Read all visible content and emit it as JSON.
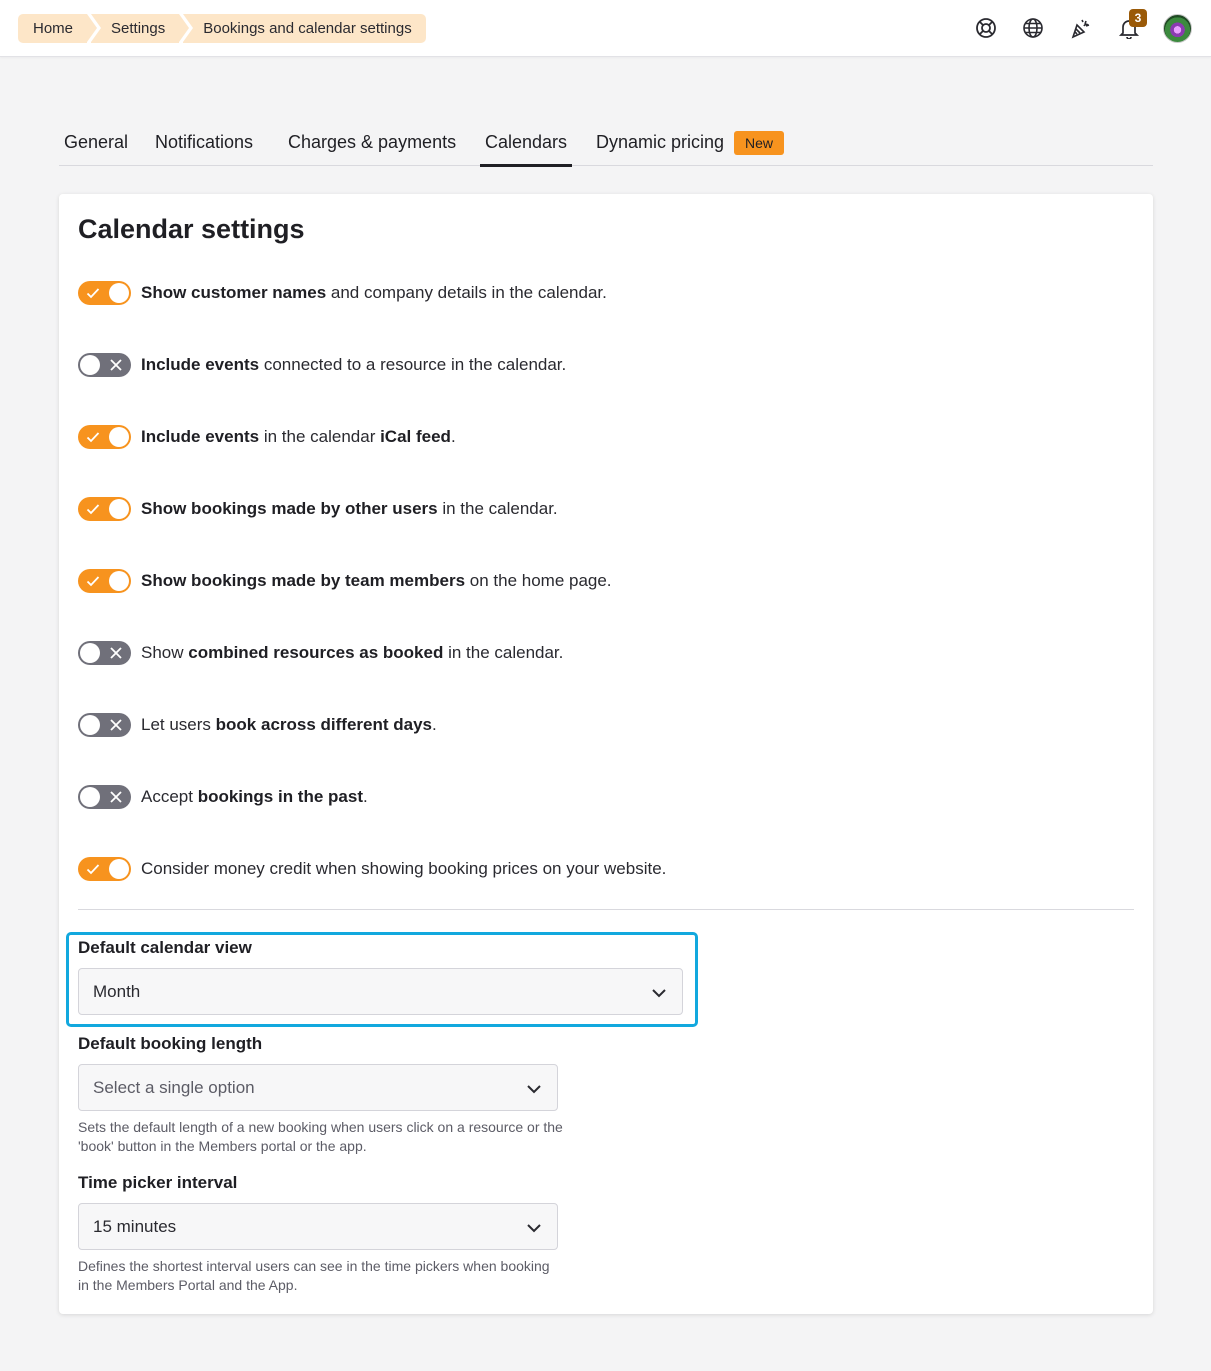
{
  "breadcrumb": [
    "Home",
    "Settings",
    "Bookings and calendar settings"
  ],
  "topbar": {
    "icons": [
      "support-icon",
      "globe-icon",
      "party-popper-icon",
      "bell-icon"
    ],
    "notifications_count": "3",
    "avatar": "user-avatar"
  },
  "tabs": [
    {
      "label": "General",
      "active": false
    },
    {
      "label": "Notifications",
      "active": false
    },
    {
      "label": "Charges & payments",
      "active": false
    },
    {
      "label": "Calendars",
      "active": true
    },
    {
      "label": "Dynamic pricing",
      "active": false
    }
  ],
  "new_badge": "New",
  "card": {
    "title": "Calendar settings",
    "settings": [
      {
        "on": true,
        "parts": [
          {
            "b": "Show customer names"
          },
          {
            "t": " and company details in the calendar."
          }
        ]
      },
      {
        "on": false,
        "parts": [
          {
            "b": "Include events"
          },
          {
            "t": " connected to a resource in the calendar."
          }
        ]
      },
      {
        "on": true,
        "parts": [
          {
            "b": "Include events"
          },
          {
            "t": " in the calendar "
          },
          {
            "b": "iCal feed"
          },
          {
            "t": "."
          }
        ]
      },
      {
        "on": true,
        "parts": [
          {
            "b": "Show bookings made by other users"
          },
          {
            "t": " in the calendar."
          }
        ]
      },
      {
        "on": true,
        "parts": [
          {
            "b": "Show bookings made by team members"
          },
          {
            "t": " on the home page."
          }
        ]
      },
      {
        "on": false,
        "parts": [
          {
            "t": "Show "
          },
          {
            "b": "combined resources as booked"
          },
          {
            "t": " in the calendar."
          }
        ]
      },
      {
        "on": false,
        "parts": [
          {
            "t": "Let users "
          },
          {
            "b": "book across different days"
          },
          {
            "t": "."
          }
        ]
      },
      {
        "on": false,
        "parts": [
          {
            "t": "Accept "
          },
          {
            "b": "bookings in the past"
          },
          {
            "t": "."
          }
        ]
      },
      {
        "on": true,
        "parts": [
          {
            "t": "Consider money credit when showing booking prices on your website."
          }
        ]
      }
    ],
    "default_calendar_view": {
      "label": "Default calendar view",
      "value": "Month"
    },
    "default_booking_length": {
      "label": "Default booking length",
      "placeholder": "Select a single option",
      "help": "Sets the default length of a new booking when users click on a resource or the 'book' button in the Members portal or the app."
    },
    "time_picker_interval": {
      "label": "Time picker interval",
      "value": "15 minutes",
      "help": "Defines the shortest interval users can see in the time pickers when booking in the Members Portal and the App."
    }
  },
  "colors": {
    "accent": "#f7931e",
    "highlight": "#12a8de",
    "toggle_off": "#70707a"
  }
}
